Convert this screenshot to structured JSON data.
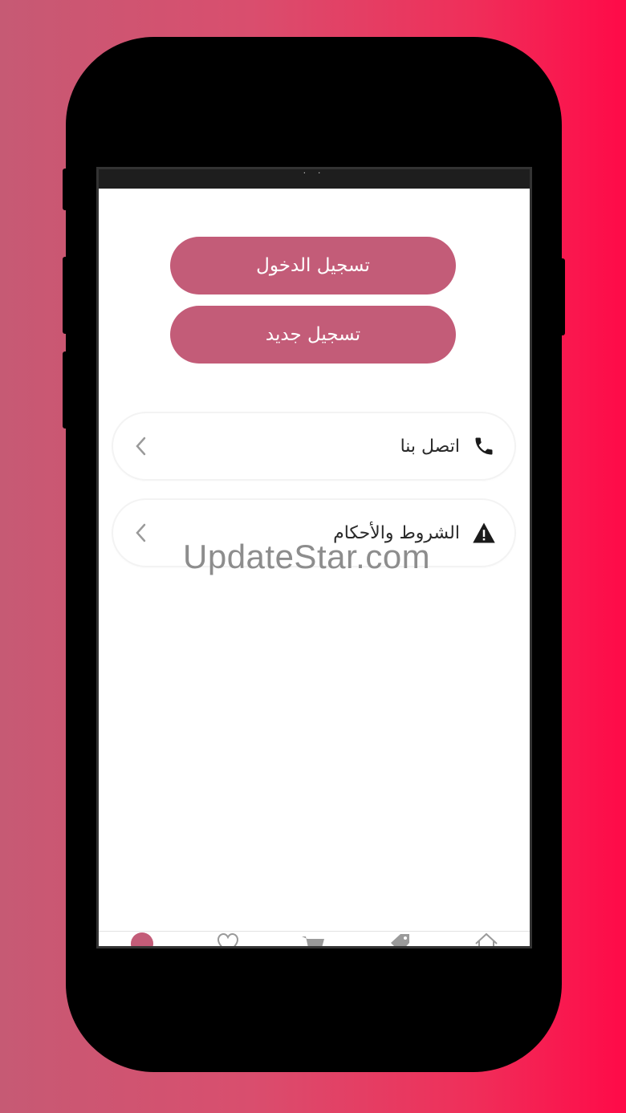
{
  "auth": {
    "login_label": "تسجيل الدخول",
    "register_label": "تسجيل جديد"
  },
  "menu": {
    "items": [
      {
        "label": "اتصل بنا",
        "icon": "phone-icon"
      },
      {
        "label": "الشروط والأحكام",
        "icon": "warning-icon"
      }
    ]
  },
  "watermark": "UpdateStar.com",
  "tabbar": {
    "tabs": [
      "profile-icon",
      "heart-icon",
      "cart-icon",
      "tag-icon",
      "home-icon"
    ],
    "active_color": "#c35c78",
    "inactive_color": "#9a9a9a"
  },
  "colors": {
    "primary": "#c35c78"
  }
}
